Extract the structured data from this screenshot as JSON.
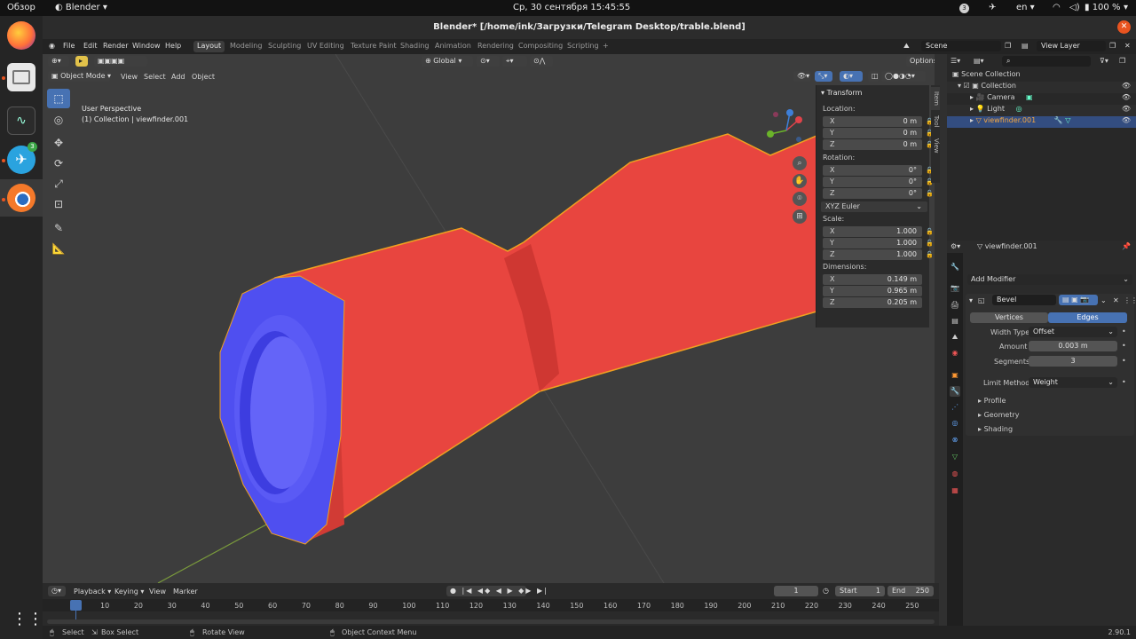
{
  "os": {
    "activities": "Обзор",
    "app_menu": "Blender",
    "clock": "Ср, 30 сентября  15:45:55",
    "notification_count": "3",
    "lang": "en",
    "battery": "100 %",
    "telegram_badge": "3"
  },
  "window": {
    "title": "Blender* [/home/ink/Загрузки/Telegram Desktop/trable.blend]",
    "version": "2.90.1"
  },
  "menubar": {
    "items": [
      "File",
      "Edit",
      "Render",
      "Window",
      "Help"
    ],
    "workspaces": [
      "Layout",
      "Modeling",
      "Sculpting",
      "UV Editing",
      "Texture Paint",
      "Shading",
      "Animation",
      "Rendering",
      "Compositing",
      "Scripting"
    ],
    "add_tab": "+",
    "scene": "Scene",
    "view_layer": "View Layer"
  },
  "viewport": {
    "mode": "Object Mode",
    "menus": [
      "View",
      "Select",
      "Add",
      "Object"
    ],
    "orientation": "Global",
    "options": "Options",
    "overlay_line1": "User Perspective",
    "overlay_line2": "(1) Collection | viewfinder.001"
  },
  "npanel": {
    "header": "Transform",
    "location_label": "Location:",
    "location": [
      {
        "axis": "X",
        "value": "0 m"
      },
      {
        "axis": "Y",
        "value": "0 m"
      },
      {
        "axis": "Z",
        "value": "0 m"
      }
    ],
    "rotation_label": "Rotation:",
    "rotation": [
      {
        "axis": "X",
        "value": "0°"
      },
      {
        "axis": "Y",
        "value": "0°"
      },
      {
        "axis": "Z",
        "value": "0°"
      }
    ],
    "rotation_mode": "XYZ Euler",
    "scale_label": "Scale:",
    "scale": [
      {
        "axis": "X",
        "value": "1.000"
      },
      {
        "axis": "Y",
        "value": "1.000"
      },
      {
        "axis": "Z",
        "value": "1.000"
      }
    ],
    "dimensions_label": "Dimensions:",
    "dimensions": [
      {
        "axis": "X",
        "value": "0.149 m"
      },
      {
        "axis": "Y",
        "value": "0.965 m"
      },
      {
        "axis": "Z",
        "value": "0.205 m"
      }
    ],
    "tabs": [
      "Item",
      "Tool",
      "View"
    ]
  },
  "timeline": {
    "menus": [
      "Playback",
      "Keying",
      "View",
      "Marker"
    ],
    "current_frame": "1",
    "start_label": "Start",
    "start": "1",
    "end_label": "End",
    "end": "250",
    "ticks": [
      "1",
      "10",
      "20",
      "30",
      "40",
      "50",
      "60",
      "70",
      "80",
      "90",
      "100",
      "110",
      "120",
      "130",
      "140",
      "150",
      "160",
      "170",
      "180",
      "190",
      "200",
      "210",
      "220",
      "230",
      "240",
      "250"
    ]
  },
  "status": {
    "select": "Select",
    "box_select": "Box Select",
    "rotate_view": "Rotate View",
    "context_menu": "Object Context Menu"
  },
  "outliner": {
    "search_placeholder": "",
    "scene_collection": "Scene Collection",
    "collection": "Collection",
    "camera": "Camera",
    "light": "Light",
    "object": "viewfinder.001"
  },
  "properties": {
    "object_name": "viewfinder.001",
    "add_modifier": "Add Modifier",
    "modifier_name": "Bevel",
    "affect_options": [
      "Vertices",
      "Edges"
    ],
    "width_type_label": "Width Type",
    "width_type": "Offset",
    "amount_label": "Amount",
    "amount": "0.003 m",
    "segments_label": "Segments",
    "segments": "3",
    "limit_method_label": "Limit Method",
    "limit_method": "Weight",
    "subpanels": [
      "Profile",
      "Geometry",
      "Shading"
    ]
  },
  "colors": {
    "accent": "#4772b3",
    "object_red": "#e8453f",
    "object_blue": "#4f4ff0",
    "selection_outline": "#f0a020",
    "ubuntu_orange": "#e95420"
  }
}
